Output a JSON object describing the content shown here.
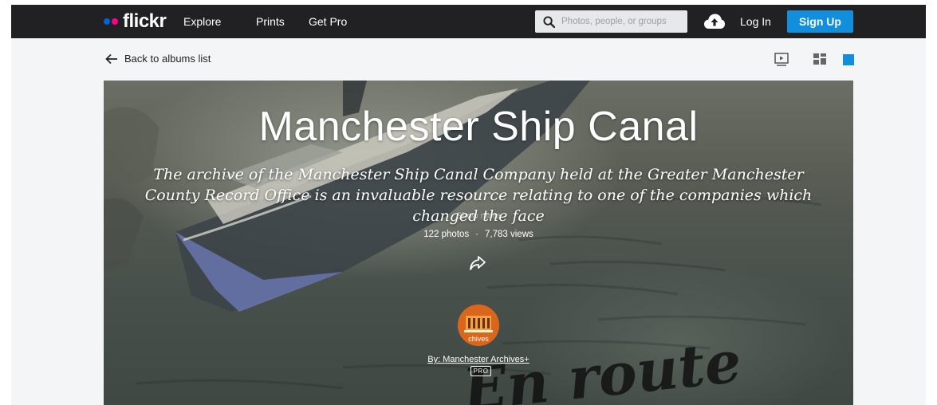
{
  "nav": {
    "logo_text": "flickr",
    "links": [
      "Explore",
      "Prints",
      "Get Pro"
    ],
    "search_placeholder": "Photos, people, or groups",
    "login_label": "Log In",
    "signup_label": "Sign Up"
  },
  "subbar": {
    "back_label": "Back to albums list"
  },
  "album": {
    "title": "Manchester Ship Canal",
    "description": "The archive of the Manchester Ship Canal Company held at the Greater Manchester County Record Office is an invaluable resource relating to one of the companies which changed the face",
    "show_more": "Show more",
    "photos": "122 photos",
    "views": "7,783 views",
    "stats_separator": "·",
    "owner_label": "By: Manchester Archives+",
    "pro_badge": "PRO",
    "background_script_text": "En route",
    "avatar_caption": "chives"
  },
  "colors": {
    "nav_bg": "#212124",
    "accent": "#128fdc",
    "logo_blue": "#0063dc",
    "logo_pink": "#ff0084"
  }
}
